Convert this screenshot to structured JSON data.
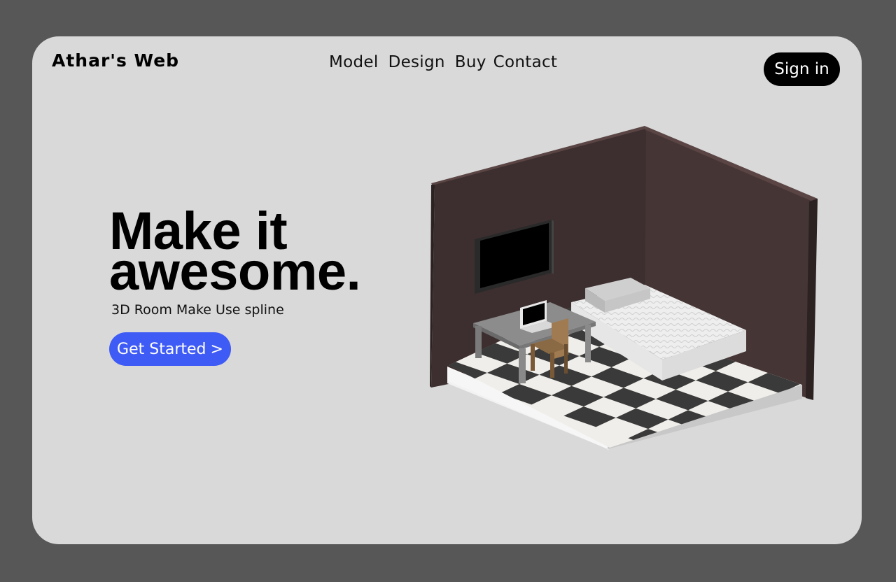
{
  "header": {
    "logo": "Athar's Web",
    "nav": [
      "Model",
      "Design",
      "Buy",
      "Contact"
    ],
    "signin_label": "Sign in"
  },
  "hero": {
    "title_line1": "Make it",
    "title_line2": "awesome.",
    "subtitle": "3D Room Make Use spline",
    "cta_label": "Get Started",
    "cta_chevron": ">"
  },
  "colors": {
    "background": "#575757",
    "card": "#d9d9d9",
    "accent": "#3f5bf5",
    "wall": "#3d2f2f"
  }
}
